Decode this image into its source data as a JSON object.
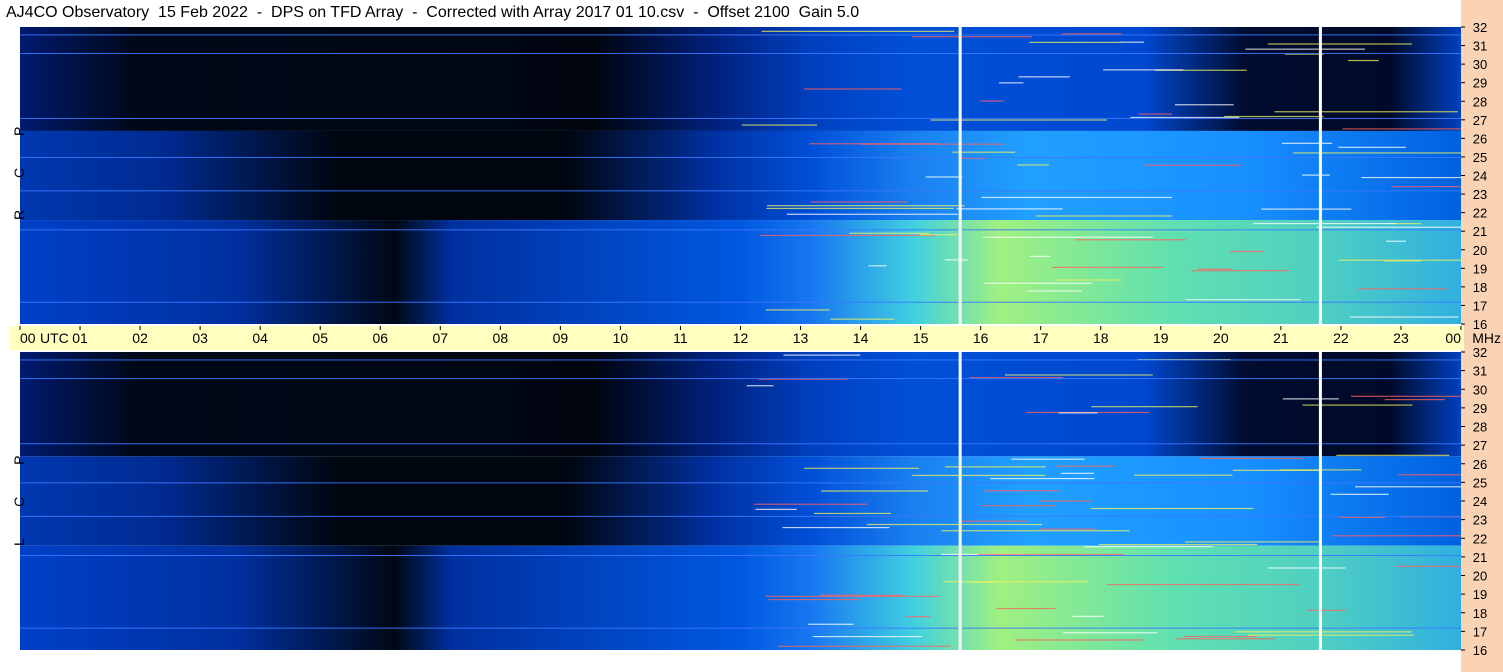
{
  "title": "AJ4CO Observatory  15 Feb 2022  -  DPS on TFD Array  -  Corrected with Array 2017 01 10.csv  -  Offset 2100  Gain 5.0",
  "colors": {
    "time_bar": "#ffffc0",
    "freq_panel": "#f9d3b4",
    "noise_floor": "#000814",
    "background": "#0040d0",
    "signal": "#30c0ff",
    "strong": "#e0f060",
    "burst_line": "#ffffff"
  },
  "panels": {
    "top_label": "R C P",
    "bottom_label": "L C P"
  },
  "chart_data": {
    "type": "heatmap",
    "title": "AJ4CO Observatory  15 Feb 2022  -  DPS on TFD Array  -  Corrected with Array 2017 01 10.csv  -  Offset 2100  Gain 5.0",
    "x_unit": "UTC",
    "y_unit": "MHz",
    "x_ticks": [
      "00",
      "01",
      "02",
      "03",
      "04",
      "05",
      "06",
      "07",
      "08",
      "09",
      "10",
      "11",
      "12",
      "13",
      "14",
      "15",
      "16",
      "17",
      "18",
      "19",
      "20",
      "21",
      "22",
      "23",
      "00"
    ],
    "y_ticks": [
      32,
      31,
      30,
      29,
      28,
      27,
      26,
      25,
      24,
      23,
      22,
      21,
      20,
      19,
      18,
      17,
      16
    ],
    "xlim": [
      0,
      24
    ],
    "ylim": [
      16,
      32
    ],
    "panels": [
      "R C P",
      "L C P"
    ],
    "vertical_bursts_utc": [
      15.65,
      21.65
    ]
  }
}
